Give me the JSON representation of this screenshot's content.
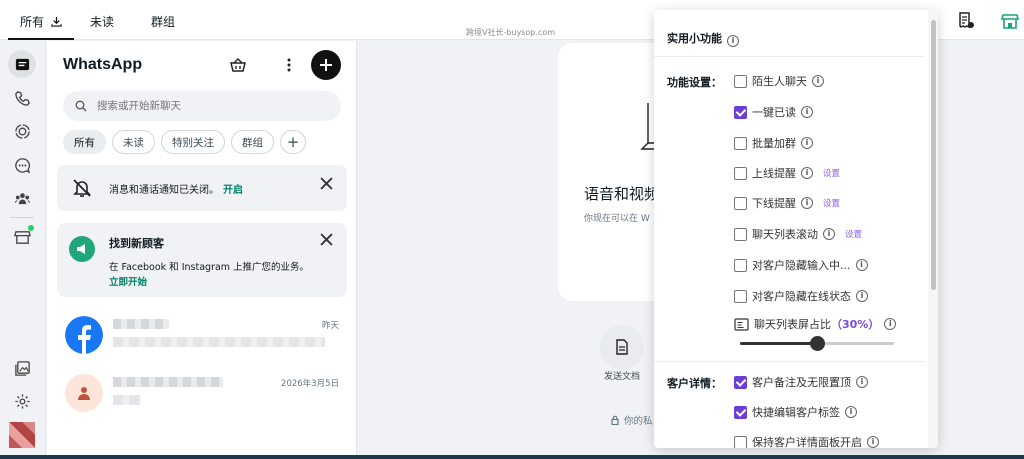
{
  "top_tabs": [
    {
      "label": "所有"
    },
    {
      "label": "未读"
    },
    {
      "label": "群组"
    }
  ],
  "watermark": "跨境V社长-buysop.com",
  "sidebar": {
    "title": "WhatsApp",
    "search_placeholder": "搜索或开始新聊天",
    "chips": [
      "所有",
      "未读",
      "特别关注",
      "群组",
      "+"
    ],
    "notice_muted": {
      "text": "消息和通话通知已关闭。",
      "cta": "开启"
    },
    "notice_promo": {
      "title": "找到新顾客",
      "body": "在 Facebook 和 Instagram 上推广您的业务。",
      "cta": "立即开始"
    },
    "chats": [
      {
        "time": "昨天"
      },
      {
        "time": "2026年3月5日"
      }
    ]
  },
  "main": {
    "heading": "语音和视频",
    "subtext": "你现在可以在 W",
    "doc_label": "发送文档",
    "e2e_text": "你的私"
  },
  "panel": {
    "title": "实用小功能",
    "section_features": "功能设置：",
    "section_customer": "客户详情：",
    "options": [
      {
        "label": "陌生人聊天",
        "checked": false,
        "info": true
      },
      {
        "label": "一键已读",
        "checked": true,
        "info": true
      },
      {
        "label": "批量加群",
        "checked": false,
        "info": true
      },
      {
        "label": "上线提醒",
        "checked": false,
        "info": true,
        "link": "设置"
      },
      {
        "label": "下线提醒",
        "checked": false,
        "info": true,
        "link": "设置"
      },
      {
        "label": "聊天列表滚动",
        "checked": false,
        "info": true,
        "link": "设置"
      },
      {
        "label": "对客户隐藏输入中...",
        "checked": false,
        "info": true
      },
      {
        "label": "对客户隐藏在线状态",
        "checked": false,
        "info": true
      }
    ],
    "ratio_label": "聊天列表屏占比",
    "ratio_value": "（30%）",
    "ratio_fraction": 0.5,
    "customer_options": [
      {
        "label": "客户备注及无限置顶",
        "checked": true,
        "info": true
      },
      {
        "label": "快捷编辑客户标签",
        "checked": true,
        "info": true
      },
      {
        "label": "保持客户详情面板开启",
        "checked": false,
        "info": true
      }
    ],
    "info_glyph": "i"
  },
  "colors": {
    "accent_green": "#008069",
    "check_purple": "#6b3fd6",
    "link_purple": "#8a5cf0"
  }
}
